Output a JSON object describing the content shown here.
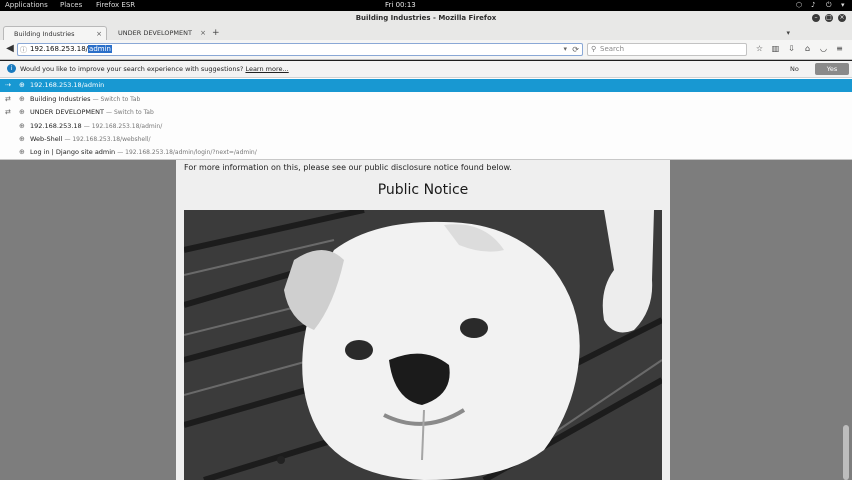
{
  "panel": {
    "applications": "Applications",
    "places": "Places",
    "active_app": "Firefox ESR",
    "clock": "Fri 00:13"
  },
  "window": {
    "title": "Building Industries - Mozilla Firefox"
  },
  "tabs": [
    {
      "label": "Building Industries"
    },
    {
      "label": "UNDER DEVELOPMENT"
    }
  ],
  "navbar": {
    "url_prefix": "192.168.253.18/",
    "url_selected": "admin",
    "search_placeholder": "Search"
  },
  "suggest_bar": {
    "message": "Would you like to improve your search experience with suggestions?",
    "learn_more": "Learn more...",
    "no_label": "No",
    "yes_label": "Yes"
  },
  "autocomplete": [
    {
      "title": "192.168.253.18/admin",
      "detail": "",
      "selected": true
    },
    {
      "title": "Building Industries",
      "detail": "— Switch to Tab",
      "selected": false
    },
    {
      "title": "UNDER DEVELOPMENT",
      "detail": "— Switch to Tab",
      "selected": false
    },
    {
      "title": "192.168.253.18",
      "detail": "— 192.168.253.18/admin/",
      "selected": false
    },
    {
      "title": "Web-Shell",
      "detail": "— 192.168.253.18/webshell/",
      "selected": false
    },
    {
      "title": "Log in | Django site admin",
      "detail": "— 192.168.253.18/admin/login/?next=/admin/",
      "selected": false
    }
  ],
  "page": {
    "notice_text": "For more information on this, please see our public disclosure notice found below.",
    "notice_title": "Public Notice"
  }
}
